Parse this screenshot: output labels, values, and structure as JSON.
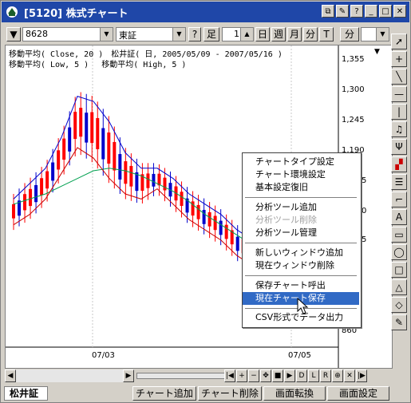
{
  "window": {
    "title": "[5120] 株式チャート"
  },
  "toolbar": {
    "code": "8628",
    "market": "東証",
    "help": "?",
    "period_label": "足",
    "period_value": "1",
    "intervals": [
      "日",
      "週",
      "月",
      "分",
      "T"
    ],
    "right_label": "分"
  },
  "chart": {
    "legend_line1": "移動平均( Close, 20 )　松井証( 日, 2005/05/09 - 2007/05/16 )",
    "legend_line2": "移動平均( Low, 5 )　 移動平均( High, 5 )",
    "price_labels": [
      "1,355",
      "1,300",
      "1,245",
      "1,190",
      "5",
      "0",
      "5",
      "860"
    ],
    "date_labels": [
      "07/03",
      "07/05"
    ],
    "colors": {
      "up": "#ff0000",
      "down": "#0000cc",
      "ma_close": "#00a050",
      "ma_low": "#cc0000",
      "ma_high": "#0000cc"
    }
  },
  "chart_data": {
    "type": "line",
    "title": "",
    "xlabel": "",
    "ylabel": "",
    "x_ticks": [
      "07/03",
      "07/05"
    ],
    "y_ticks": [
      860,
      1190,
      1245,
      1300,
      1355
    ],
    "series": [
      {
        "name": "移動平均( Close, 20 )",
        "values": [
          1110,
          1120,
          1130,
          1145,
          1160,
          1175,
          1180,
          1175,
          1165,
          1150,
          1135,
          1115,
          1090,
          1070,
          1050,
          1030,
          1010,
          990,
          975,
          960,
          950
        ]
      },
      {
        "name": "移動平均( Low, 5 )",
        "values": [
          1070,
          1090,
          1120,
          1170,
          1220,
          1200,
          1160,
          1130,
          1120,
          1140,
          1110,
          1080,
          1060,
          1040,
          1010,
          990,
          975,
          960,
          945,
          930,
          920
        ]
      },
      {
        "name": "移動平均( High, 5 )",
        "values": [
          1120,
          1150,
          1180,
          1240,
          1320,
          1310,
          1270,
          1210,
          1180,
          1180,
          1160,
          1130,
          1110,
          1090,
          1060,
          1040,
          1020,
          1000,
          985,
          970,
          960
        ]
      }
    ]
  },
  "context_menu": {
    "items": [
      {
        "label": "チャートタイプ設定",
        "disabled": false
      },
      {
        "label": "チャート環境設定",
        "disabled": false
      },
      {
        "label": "基本設定復旧",
        "disabled": false
      },
      {
        "label": "分析ツール追加",
        "disabled": false
      },
      {
        "label": "分析ツール削除",
        "disabled": true
      },
      {
        "label": "分析ツール管理",
        "disabled": false
      },
      {
        "label": "新しいウィンドウ追加",
        "disabled": false
      },
      {
        "label": "現在ウィンドウ削除",
        "disabled": false
      },
      {
        "label": "保存チャート呼出",
        "disabled": false
      },
      {
        "label": "現在チャート保存",
        "disabled": false,
        "highlighted": true
      },
      {
        "label": "CSV形式でデータ出力",
        "disabled": false
      }
    ]
  },
  "navigation": {
    "buttons": [
      "|◀",
      "+",
      "−",
      "✥",
      "■",
      "▶",
      "D",
      "L",
      "R",
      "⊕",
      "✕",
      "|▶"
    ]
  },
  "statusbar": {
    "tab": "松井証",
    "buttons": [
      "チャート追加",
      "チャート削除",
      "画面転換",
      "画面設定"
    ]
  },
  "right_tools": [
    "pointer-icon",
    "crosshair-icon",
    "trendline-icon",
    "hline-icon",
    "vline-icon",
    "bell-icon",
    "fork-icon",
    "bars-icon",
    "box-icon",
    "step-icon",
    "text-icon",
    "rect-icon",
    "ellipse-icon",
    "square-icon",
    "triangle-icon",
    "eraser-icon",
    "marker-icon"
  ]
}
